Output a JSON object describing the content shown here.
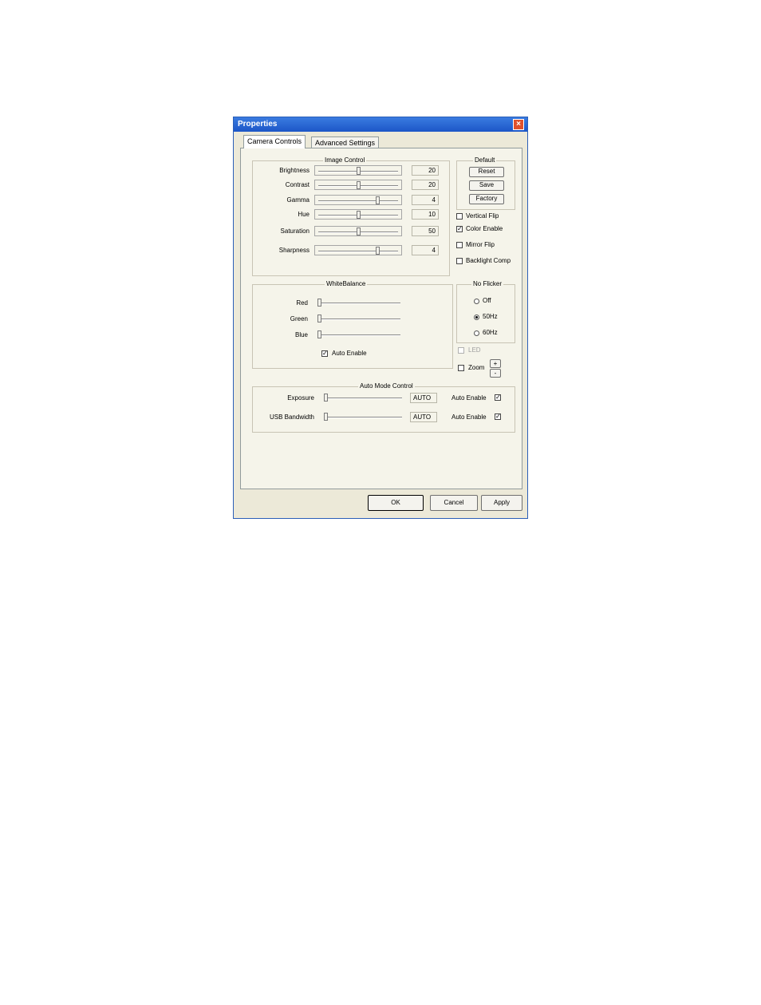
{
  "window": {
    "title": "Properties"
  },
  "tabs": [
    {
      "label": "Camera Controls"
    },
    {
      "label": "Advanced Settings"
    }
  ],
  "image_control": {
    "legend": "Image Control",
    "sliders": [
      {
        "label": "Brightness",
        "value": "20",
        "level": 0.5
      },
      {
        "label": "Contrast",
        "value": "20",
        "level": 0.5
      },
      {
        "label": "Gamma",
        "value": "4",
        "level": 0.75
      },
      {
        "label": "Hue",
        "value": "10",
        "level": 0.5
      },
      {
        "label": "Saturation",
        "value": "50",
        "level": 0.5
      },
      {
        "label": "Sharpness",
        "value": "4",
        "level": 0.75
      }
    ]
  },
  "default_group": {
    "legend": "Default",
    "buttons": [
      {
        "label": "Reset"
      },
      {
        "label": "Save"
      },
      {
        "label": "Factory"
      }
    ]
  },
  "options": [
    {
      "label": "Vertical Flip",
      "checked": false
    },
    {
      "label": "Color Enable",
      "checked": true
    },
    {
      "label": "Mirror Flip",
      "checked": false
    },
    {
      "label": "Backlight Comp",
      "checked": false
    }
  ],
  "white_balance": {
    "legend": "WhiteBalance",
    "sliders": [
      {
        "label": "Red",
        "level": 0.0
      },
      {
        "label": "Green",
        "level": 0.0
      },
      {
        "label": "Blue",
        "level": 0.0
      }
    ],
    "auto_enable": {
      "label": "Auto Enable",
      "checked": true
    }
  },
  "no_flicker": {
    "legend": "No Flicker",
    "options": [
      {
        "label": "Off",
        "selected": false
      },
      {
        "label": "50Hz",
        "selected": true
      },
      {
        "label": "60Hz",
        "selected": false
      }
    ]
  },
  "led": {
    "label": "LED",
    "checked": false,
    "disabled": true
  },
  "zoom": {
    "label": "Zoom",
    "checked": false,
    "up": "+",
    "down": "-"
  },
  "auto_mode": {
    "legend": "Auto Mode Control",
    "rows": [
      {
        "label": "Exposure",
        "value": "AUTO",
        "level": 0.0,
        "auto_label": "Auto Enable",
        "auto_checked": true
      },
      {
        "label": "USB Bandwidth",
        "value": "AUTO",
        "level": 0.0,
        "auto_label": "Auto Enable",
        "auto_checked": true
      }
    ]
  },
  "footer": {
    "ok": "OK",
    "cancel": "Cancel",
    "apply": "Apply"
  },
  "check_glyph": "✓"
}
